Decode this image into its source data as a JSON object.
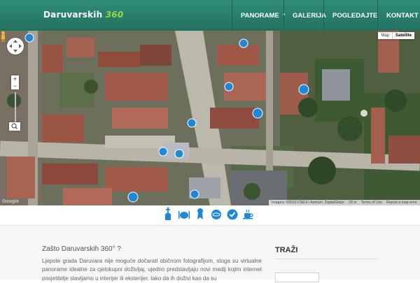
{
  "header": {
    "logo_text": "Daruvarskih",
    "logo_number": "360",
    "nav": [
      {
        "label": "PANORAME",
        "has_dropdown": true
      },
      {
        "label": "GALERIJA"
      },
      {
        "label": "POGLEDAJTE"
      },
      {
        "label": "KONTAKT"
      }
    ]
  },
  "map": {
    "map_type": {
      "map": "Map",
      "satellite": "Satellite",
      "selected": "Satellite"
    },
    "attribution": {
      "imagery": "Imagery ©2015 CNES / Astrium, DigitalGlobe",
      "scale": "20 m",
      "terms": "Terms of Use",
      "report": "Report a map error"
    },
    "google_brand": "Google",
    "marker_color": "#1e88d6"
  },
  "icon_strip": {
    "icons": [
      "church-icon",
      "restaurant-icon",
      "monument-icon",
      "panorama-icon",
      "checkmark-icon",
      "coffee-icon"
    ]
  },
  "content": {
    "intro_title": "Zašto Daruvarskih 360° ?",
    "intro_text": "Ljepote grada Daruvara nije moguće dočarati običnom fotografijom, stoga su virtualne panorame idealne za cjelokupni doživljaj, ujedno predstavljaju novi medij kojim internet posjetitelje stavljamo u interijer ili eksterijer, tako da ih doživi kao da su",
    "sidebar_title": "TRAŽI"
  },
  "colors": {
    "header_bg": "#2a7f6c",
    "accent_green": "#9ad84a",
    "marker_blue": "#1e88d6"
  }
}
